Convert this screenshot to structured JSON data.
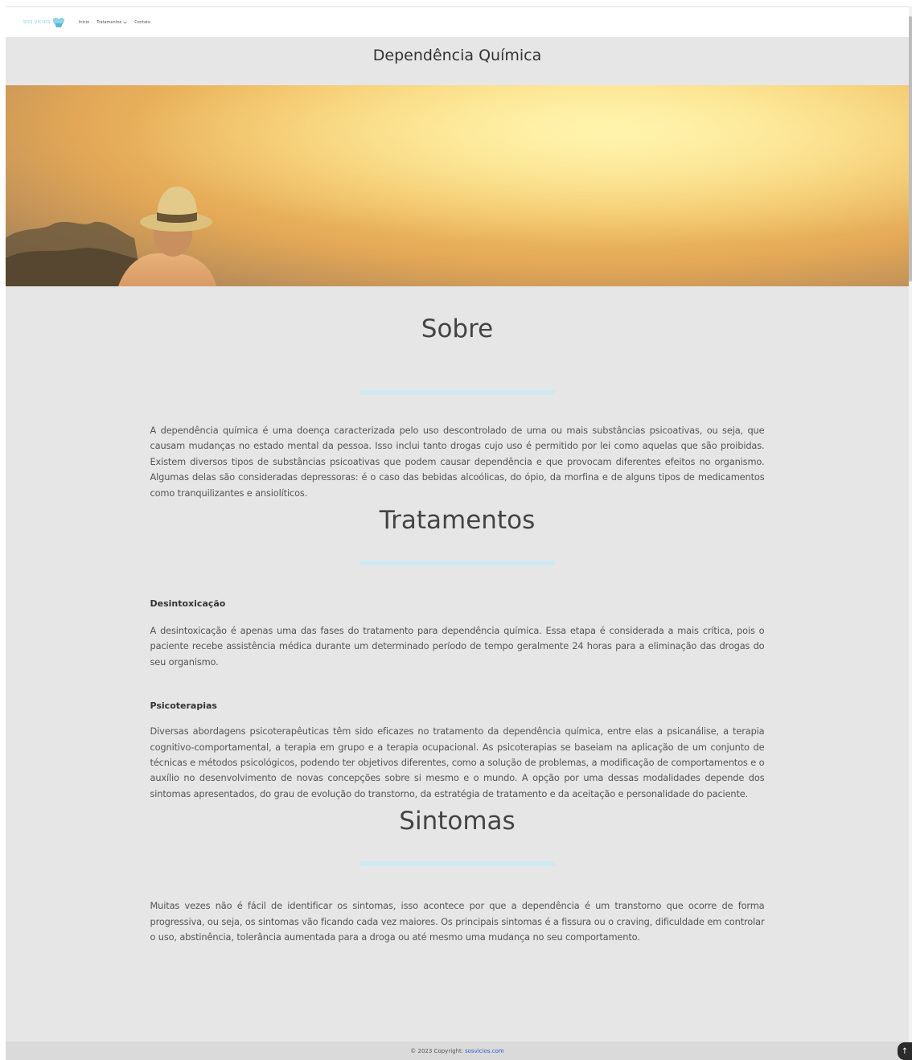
{
  "nav": {
    "logo_text": "SOS VICIOS",
    "links": [
      {
        "label": "Início"
      },
      {
        "label": "Tratamentos"
      },
      {
        "label": "Contato"
      }
    ]
  },
  "page_title": "Dependência Química",
  "sections": {
    "sobre": {
      "title": "Sobre",
      "text": "A dependência química é uma doença caracterizada pelo uso descontrolado de uma ou mais substâncias psicoativas, ou seja, que causam mudanças no estado mental da pessoa. Isso inclui tanto drogas cujo uso é permitido por lei como aquelas que são proibidas. Existem diversos tipos de substâncias psicoativas que podem causar dependência e que provocam diferentes efeitos no organismo. Algumas delas são consideradas depressoras: é o caso das bebidas alcoólicas, do ópio, da morfina e de alguns tipos de medicamentos como tranquilizantes e ansiolíticos."
    },
    "tratamentos": {
      "title": "Tratamentos",
      "items": [
        {
          "heading": "Desintoxicação",
          "text": "A desintoxicação é apenas uma das fases do tratamento para dependência química. Essa etapa é considerada a mais crítica, pois o paciente recebe assistência médica durante um determinado período de tempo geralmente 24 horas para a eliminação das drogas do seu organismo."
        },
        {
          "heading": "Psicoterapias",
          "text": "Diversas abordagens psicoterapêuticas têm sido eficazes no tratamento da dependência química, entre elas a psicanálise, a terapia cognitivo-comportamental, a terapia em grupo e a terapia ocupacional. As psicoterapias se baseiam na aplicação de um conjunto de técnicas e métodos psicológicos, podendo ter objetivos diferentes, como a solução de problemas, a modificação de comportamentos e o auxílio no desenvolvimento de novas concepções sobre si mesmo e o mundo. A opção por uma dessas modalidades depende dos sintomas apresentados, do grau de evolução do transtorno, da estratégia de tratamento e da aceitação e personalidade do paciente."
        }
      ]
    },
    "sintomas": {
      "title": "Sintomas",
      "text": "Muitas vezes não é fácil de identificar os sintomas, isso acontece por que a dependência é um transtorno que ocorre de forma progressiva, ou seja, os sintomas vão ficando cada vez maiores. Os principais sintomas é a fissura ou o craving, dificuldade em controlar o uso, abstinência, tolerância aumentada para a droga ou até mesmo uma mudança no seu comportamento."
    }
  },
  "footer": {
    "copyright": "© 2023 Copyright:",
    "link": "sosvicios.com"
  },
  "back_to_top": "↑",
  "colors": {
    "accent_divider": "#cfe9f1",
    "link": "#3355cc",
    "page_bg": "#e6e6e6"
  }
}
